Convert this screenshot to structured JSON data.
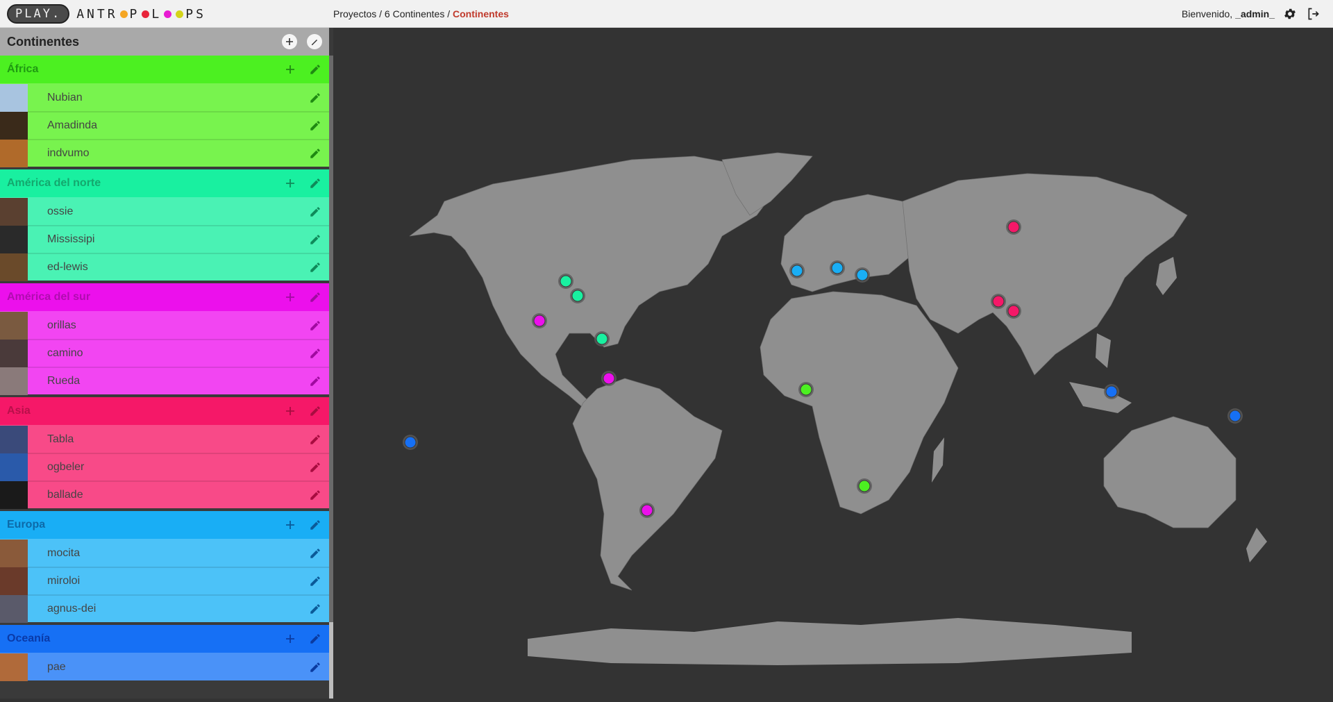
{
  "header": {
    "logo_play": "PLAY.",
    "logo_anthro": "ANTHROPOLOOPS",
    "breadcrumbs": {
      "projects": "Proyectos",
      "sep1": " / ",
      "project": "6 Continentes",
      "sep2": " / ",
      "current": "Continentes"
    },
    "welcome": "Bienvenido,",
    "username": "_admin_",
    "icons": [
      "gear-icon",
      "logout-icon"
    ]
  },
  "sidebar": {
    "title": "Continentes",
    "groups": [
      {
        "name": "África",
        "head_color": "#4cf021",
        "item_color": "#78f34e",
        "text_color": "#1f9a12",
        "pen_color": "#1f8a12",
        "items": [
          {
            "label": "Nubian",
            "thumb": "#a8c4e0"
          },
          {
            "label": "Amadinda",
            "thumb": "#3a2a1a"
          },
          {
            "label": "indvumo",
            "thumb": "#b06a2a"
          }
        ]
      },
      {
        "name": "América del norte",
        "head_color": "#19f0a0",
        "item_color": "#4af2b4",
        "text_color": "#14a86e",
        "pen_color": "#0f8a5a",
        "items": [
          {
            "label": "ossie",
            "thumb": "#5a4030"
          },
          {
            "label": "Mississipi",
            "thumb": "#2a2a2a"
          },
          {
            "label": "ed-lewis",
            "thumb": "#6a4a2a"
          }
        ]
      },
      {
        "name": "América del sur",
        "head_color": "#ec10ec",
        "item_color": "#f245f2",
        "text_color": "#b00cb0",
        "pen_color": "#a00aa0",
        "items": [
          {
            "label": "orillas",
            "thumb": "#7a5a40"
          },
          {
            "label": "camino",
            "thumb": "#4a3a3a"
          },
          {
            "label": "Rueda",
            "thumb": "#8a7a7a"
          }
        ]
      },
      {
        "name": "Asia",
        "head_color": "#f51868",
        "item_color": "#f84a88",
        "text_color": "#b8104a",
        "pen_color": "#a80c40",
        "items": [
          {
            "label": "Tabla",
            "thumb": "#3a4a7a"
          },
          {
            "label": "ogbeler",
            "thumb": "#2a5aaa"
          },
          {
            "label": "ballade",
            "thumb": "#1a1a1a"
          }
        ]
      },
      {
        "name": "Europa",
        "head_color": "#19aef5",
        "item_color": "#4cc2f8",
        "text_color": "#0d6aa8",
        "pen_color": "#0b5a98",
        "items": [
          {
            "label": "mocita",
            "thumb": "#8a5a3a"
          },
          {
            "label": "miroloi",
            "thumb": "#6a3a2a"
          },
          {
            "label": "agnus-dei",
            "thumb": "#5a5a6a"
          }
        ]
      },
      {
        "name": "Oceanía",
        "head_color": "#1670f5",
        "item_color": "#4a92f8",
        "text_color": "#0a3aa8",
        "pen_color": "#0a3aa0",
        "items": [
          {
            "label": "pae",
            "thumb": "#b06a3a"
          }
        ]
      }
    ]
  },
  "map": {
    "land_color": "#8f8f8f",
    "background": "#333333",
    "markers": [
      {
        "continent": "América del norte",
        "color": "#19f0a0"
      },
      {
        "continent": "América del norte",
        "color": "#19f0a0"
      },
      {
        "continent": "América del norte",
        "color": "#19f0a0"
      },
      {
        "continent": "América del sur",
        "color": "#ec10ec"
      },
      {
        "continent": "América del sur",
        "color": "#ec10ec"
      },
      {
        "continent": "América del sur",
        "color": "#ec10ec"
      },
      {
        "continent": "África",
        "color": "#4cf021"
      },
      {
        "continent": "África",
        "color": "#4cf021"
      },
      {
        "continent": "Europa",
        "color": "#19aef5"
      },
      {
        "continent": "Europa",
        "color": "#19aef5"
      },
      {
        "continent": "Europa",
        "color": "#19aef5"
      },
      {
        "continent": "Asia",
        "color": "#f51868"
      },
      {
        "continent": "Asia",
        "color": "#f51868"
      },
      {
        "continent": "Asia",
        "color": "#f51868"
      },
      {
        "continent": "Oceanía",
        "color": "#1670f5"
      },
      {
        "continent": "Oceanía",
        "color": "#1670f5"
      },
      {
        "continent": "Oceanía",
        "color": "#1670f5"
      }
    ]
  }
}
